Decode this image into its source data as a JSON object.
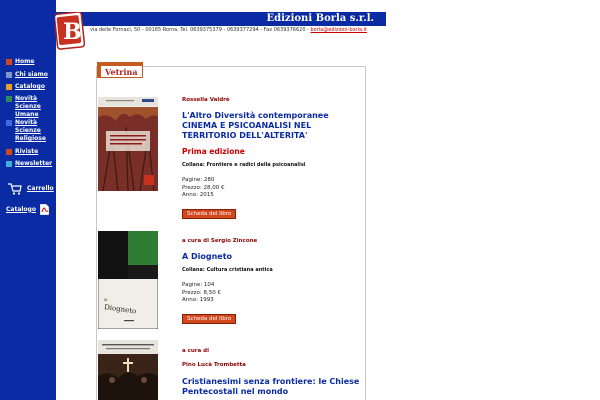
{
  "header": {
    "site_title": "Edizioni Borla s.r.l.",
    "address": "via delle Fornaci, 50 - 00165 Roma. Tel. 0639375379 - 0639377294 - Fax 0639376620 - ",
    "email": "borla@edizioni-borla.it"
  },
  "logo": {
    "letter": "B"
  },
  "sidebar": {
    "items": [
      {
        "label": "Home",
        "color": "#d2481e"
      },
      {
        "label": "Chi siamo",
        "color": "#7f97c4"
      },
      {
        "label": "Catalogo",
        "color": "#e8a020"
      },
      {
        "label": "Novità Scienze Umane",
        "color": "#2e8b57"
      },
      {
        "label": "Novità Scienze Religiose",
        "color": "#4169e1"
      },
      {
        "label": "Riviste",
        "color": "#d2481e"
      },
      {
        "label": "Newsletter",
        "color": "#40b0d8"
      }
    ],
    "cart_label": "Carrello",
    "catalog_pdf_label": "Catalogo"
  },
  "vetrina": {
    "label": "Vetrina"
  },
  "books": [
    {
      "author": "Rossella Valdrè",
      "title": "L'Altro Diversità contemporanee CINEMA E PSICOANALISI NEL TERRITORIO DELL'ALTERITA'",
      "edition": "Prima edizione",
      "collana": "Collana: Frontiere e radici della psicoanalisi",
      "pages": "Pagine:  280",
      "price": "Prezzo:   28,00 €",
      "year": "Anno:  2015",
      "button": "Scheda del libro"
    },
    {
      "author": "a cura di Sergio Zincone",
      "title": "A Diogneto",
      "collana": "Collana: Cultura cristiana antica",
      "pages": "Pagine:  104",
      "price": "Prezzo:   8,50 €",
      "year": "Anno:  1993",
      "button": "Scheda del libro"
    },
    {
      "author": "a cura di",
      "sub_author": "Pino Lucà Trombetta",
      "title": "Cristianesimi senza frontiere: le Chiese Pentecostali nel mondo"
    }
  ],
  "colors": {
    "brand_blue": "#0b2ba4",
    "accent_red": "#cc0000",
    "button_orange": "#d2481e"
  }
}
